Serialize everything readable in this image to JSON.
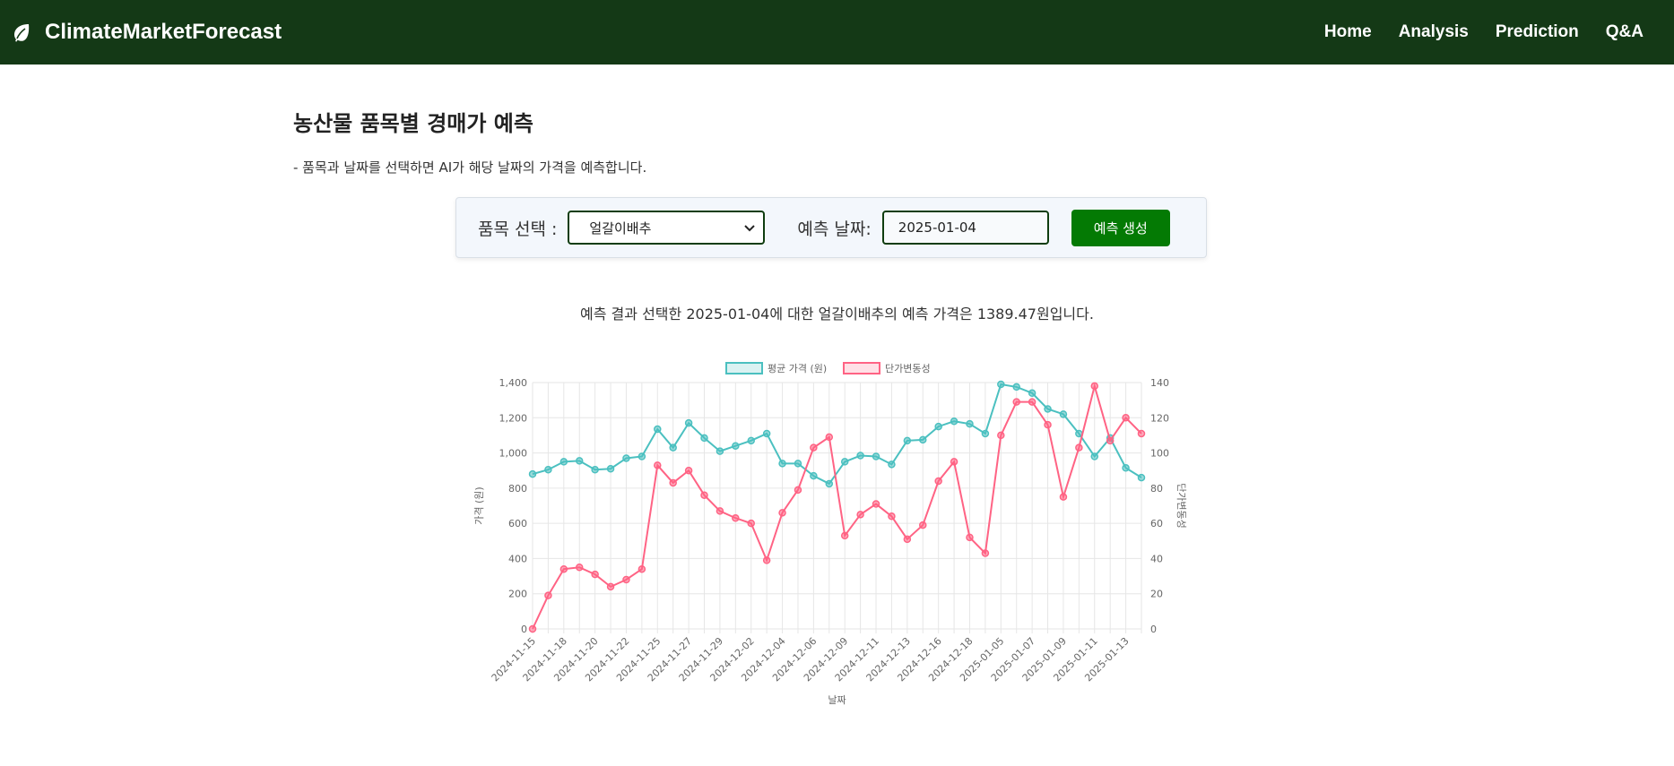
{
  "navbar": {
    "brand": "ClimateMarketForecast",
    "links": [
      "Home",
      "Analysis",
      "Prediction",
      "Q&A"
    ],
    "bg_color": "#143916"
  },
  "page": {
    "title": "농산물 품목별 경매가 예측",
    "description": "- 품목과 날짜를 선택하면 AI가 해당 날짜의 가격을 예측합니다."
  },
  "form": {
    "item_label": "품목 선택 :",
    "item_value": "얼갈이배추",
    "date_label": "예측 날짜:",
    "date_value": "2025-01-04",
    "button_label": "예측 생성",
    "button_color": "#047a04"
  },
  "result": {
    "text": "예측 결과 선택한 2025-01-04에 대한 얼갈이배추의 예측 가격은 1389.47원입니다."
  },
  "chart_data": {
    "type": "line",
    "xlabel": "날짜",
    "ylabel_left": "가격 (원)",
    "ylabel_right": "단가변동성",
    "ylim_left": [
      0,
      1400
    ],
    "ylim_right": [
      0,
      140
    ],
    "yticks_left": [
      0,
      200,
      400,
      600,
      800,
      1000,
      1200,
      1400
    ],
    "yticks_right": [
      0,
      20,
      40,
      60,
      80,
      100,
      120,
      140
    ],
    "grid": true,
    "legend_position": "top",
    "x": [
      "2024-11-15",
      "2024-11-16",
      "2024-11-18",
      "2024-11-19",
      "2024-11-20",
      "2024-11-21",
      "2024-11-22",
      "2024-11-23",
      "2024-11-25",
      "2024-11-26",
      "2024-11-27",
      "2024-11-28",
      "2024-11-29",
      "2024-11-30",
      "2024-12-02",
      "2024-12-03",
      "2024-12-04",
      "2024-12-05",
      "2024-12-06",
      "2024-12-07",
      "2024-12-09",
      "2024-12-10",
      "2024-12-11",
      "2024-12-12",
      "2024-12-13",
      "2024-12-14",
      "2024-12-16",
      "2024-12-17",
      "2024-12-18",
      "2024-12-19",
      "2025-01-05",
      "2025-01-06",
      "2025-01-07",
      "2025-01-08",
      "2025-01-09",
      "2025-01-10",
      "2025-01-11",
      "2025-01-12",
      "2025-01-13",
      "2025-01-14"
    ],
    "x_tick_labels": [
      "2024-11-15",
      "2024-11-18",
      "2024-11-20",
      "2024-11-22",
      "2024-11-25",
      "2024-11-27",
      "2024-11-29",
      "2024-12-02",
      "2024-12-04",
      "2024-12-06",
      "2024-12-09",
      "2024-12-11",
      "2024-12-13",
      "2024-12-16",
      "2024-12-18",
      "2025-01-05",
      "2025-01-07",
      "2025-01-09",
      "2025-01-11",
      "2025-01-13"
    ],
    "series": [
      {
        "name": "평균 가격 (원)",
        "axis": "left",
        "color": "#4bc0c0",
        "values": [
          880,
          905,
          950,
          955,
          905,
          910,
          970,
          980,
          1135,
          1030,
          1170,
          1085,
          1010,
          1040,
          1070,
          1110,
          940,
          940,
          870,
          825,
          950,
          985,
          980,
          935,
          1070,
          1075,
          1150,
          1180,
          1165,
          1110,
          1390,
          1375,
          1340,
          1250,
          1220,
          1110,
          980,
          1085,
          915,
          860
        ]
      },
      {
        "name": "단가변동성",
        "axis": "right",
        "color": "#ff6384",
        "values": [
          0,
          19,
          34,
          35,
          31,
          24,
          28,
          34,
          93,
          83,
          90,
          76,
          67,
          63,
          60,
          39,
          66,
          79,
          103,
          109,
          53,
          65,
          71,
          64,
          51,
          59,
          84,
          95,
          52,
          43,
          110,
          129,
          129,
          116,
          75,
          103,
          138,
          107,
          120,
          111
        ]
      }
    ]
  }
}
